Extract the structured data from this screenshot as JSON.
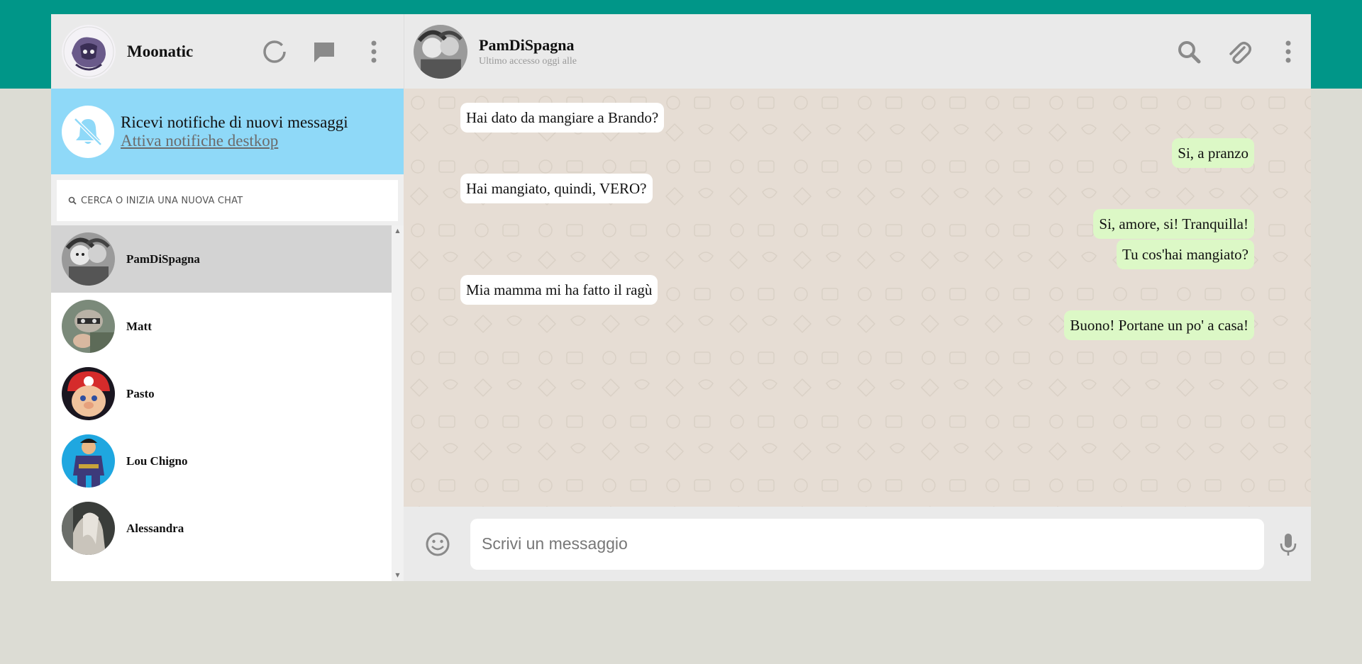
{
  "colors": {
    "brand": "#009688",
    "sent_bubble": "#dcf8c6",
    "notification_bg": "#8fd9f8",
    "active_chat": "#d3d3d3"
  },
  "user": {
    "name": "Moonatic",
    "avatar_icon": "user-avatar-icon"
  },
  "sidebar_icons": [
    "status-icon",
    "new-chat-icon",
    "menu-dots-icon"
  ],
  "notification": {
    "title": "Ricevi notifiche di nuovi messaggi",
    "link": "Attiva notifiche destkop",
    "icon": "bell-off-icon"
  },
  "search": {
    "placeholder": "CERCA O INIZIA UNA NUOVA CHAT"
  },
  "chats": [
    {
      "name": "PamDiSpagna",
      "active": true
    },
    {
      "name": "Matt",
      "active": false
    },
    {
      "name": "Pasto",
      "active": false
    },
    {
      "name": "Lou Chigno",
      "active": false
    },
    {
      "name": "Alessandra",
      "active": false
    }
  ],
  "conversation": {
    "contact_name": "PamDiSpagna",
    "contact_status": "Ultimo accesso oggi alle",
    "header_icons": [
      "search-icon",
      "attach-icon",
      "menu-dots-icon"
    ]
  },
  "messages": [
    {
      "type": "received",
      "text": "Hai dato da mangiare a Brando?"
    },
    {
      "type": "sent",
      "text": "Si, a pranzo"
    },
    {
      "type": "received",
      "text": "Hai mangiato, quindi, VERO?"
    },
    {
      "type": "sent",
      "text": "Si, amore, si! Tranquilla!"
    },
    {
      "type": "sent",
      "text": "Tu cos'hai mangiato?"
    },
    {
      "type": "received",
      "text": "Mia mamma mi ha fatto il ragù"
    },
    {
      "type": "sent",
      "text": "Buono! Portane un po' a casa!"
    }
  ],
  "composer": {
    "placeholder": "Scrivi un messaggio",
    "emoji_icon": "emoji-icon",
    "mic_icon": "microphone-icon"
  }
}
